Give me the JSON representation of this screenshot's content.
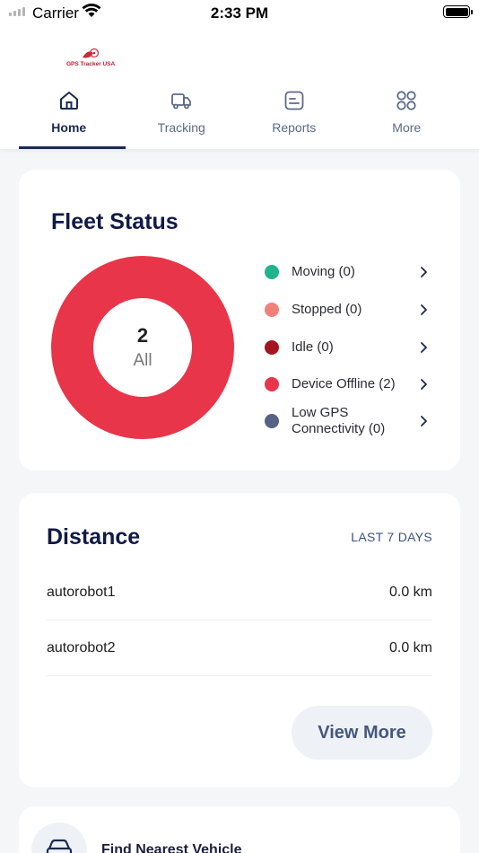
{
  "status_bar": {
    "carrier": "Carrier",
    "time": "2:33 PM"
  },
  "header": {
    "logo_text": "GPS Tracker USA"
  },
  "nav": {
    "tabs": [
      {
        "label": "Home",
        "icon": "home-icon",
        "active": true
      },
      {
        "label": "Tracking",
        "icon": "truck-icon",
        "active": false
      },
      {
        "label": "Reports",
        "icon": "reports-icon",
        "active": false
      },
      {
        "label": "More",
        "icon": "grid-icon",
        "active": false
      }
    ]
  },
  "fleet_status": {
    "title": "Fleet Status",
    "total": "2",
    "total_label": "All",
    "items": [
      {
        "label": "Moving (0)",
        "count": 0,
        "color": "#1fb38e"
      },
      {
        "label": "Stopped (0)",
        "count": 0,
        "color": "#f0817a"
      },
      {
        "label": "Idle (0)",
        "count": 0,
        "color": "#a3141f"
      },
      {
        "label": "Device Offline (2)",
        "count": 2,
        "color": "#e93549"
      },
      {
        "label": "Low GPS Connectivity (0)",
        "count": 0,
        "color": "#566385"
      }
    ]
  },
  "distance": {
    "title": "Distance",
    "range": "LAST 7 DAYS",
    "rows": [
      {
        "name": "autorobot1",
        "value": "0.0 km"
      },
      {
        "name": "autorobot2",
        "value": "0.0 km"
      }
    ],
    "view_more": "View More"
  },
  "nearest": {
    "label": "Find Nearest Vehicle"
  },
  "colors": {
    "primary": "#1b2a4e",
    "donut": "#e93549",
    "card_bg": "#ffffff",
    "page_bg": "#f4f6f8"
  }
}
